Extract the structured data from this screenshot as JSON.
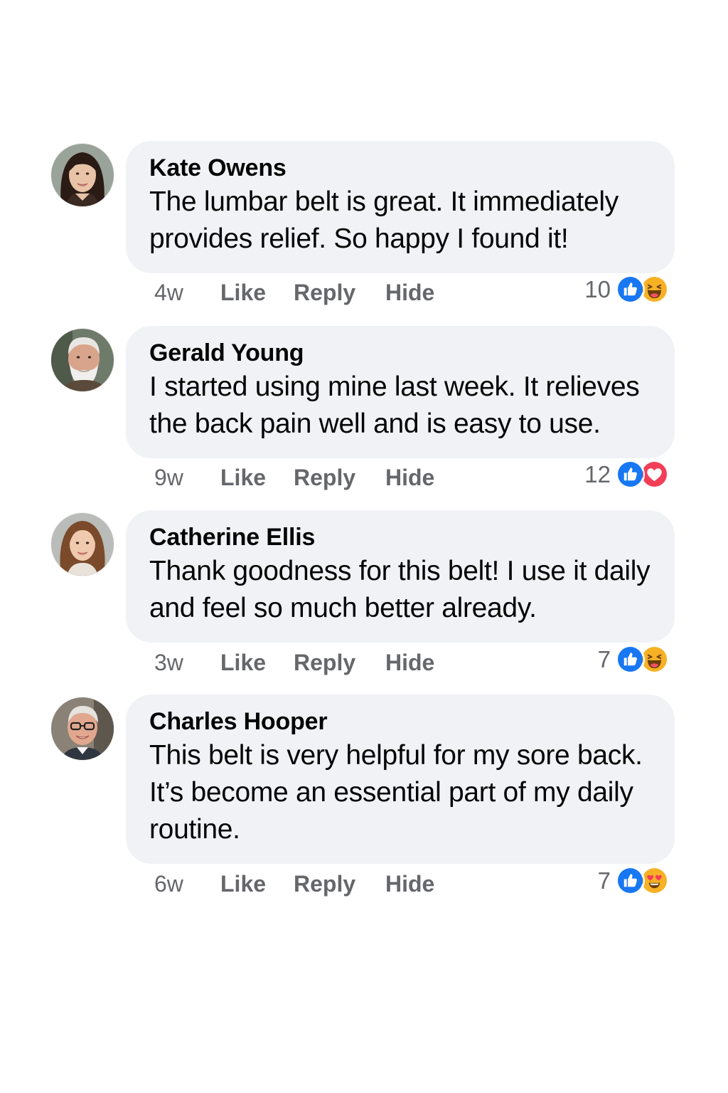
{
  "comments": [
    {
      "author": "Kate Owens",
      "text": "The lumbar belt is great. It immediately provides relief. So happy I found it!",
      "time": "4w",
      "like_label": "Like",
      "reply_label": "Reply",
      "hide_label": "Hide",
      "reaction_count": "10",
      "reactions": [
        "like-icon",
        "haha-icon"
      ],
      "avatar": "woman-dark-hair"
    },
    {
      "author": "Gerald Young",
      "text": "I started using mine last week. It relieves the back pain well and is easy to use.",
      "time": "9w",
      "like_label": "Like",
      "reply_label": "Reply",
      "hide_label": "Hide",
      "reaction_count": "12",
      "reactions": [
        "like-icon",
        "love-icon"
      ],
      "avatar": "older-man-white-beard"
    },
    {
      "author": "Catherine Ellis",
      "text": "Thank goodness for this belt! I use it daily and feel so much better already.",
      "time": "3w",
      "like_label": "Like",
      "reply_label": "Reply",
      "hide_label": "Hide",
      "reaction_count": "7",
      "reactions": [
        "like-icon",
        "haha-icon"
      ],
      "avatar": "woman-light-brown-hair"
    },
    {
      "author": "Charles Hooper",
      "text": "This belt is very helpful for my sore back. It’s become an essential part of my daily routine.",
      "time": "6w",
      "like_label": "Like",
      "reply_label": "Reply",
      "hide_label": "Hide",
      "reaction_count": "7",
      "reactions": [
        "like-icon",
        "heart-eyes-icon"
      ],
      "avatar": "older-man-glasses"
    }
  ],
  "colors": {
    "bubble": "#f0f2f5",
    "secondary_text": "#65676b",
    "like_blue": "#1877f2",
    "love_red": "#f33e58",
    "haha_yellow": "#f7b125"
  }
}
